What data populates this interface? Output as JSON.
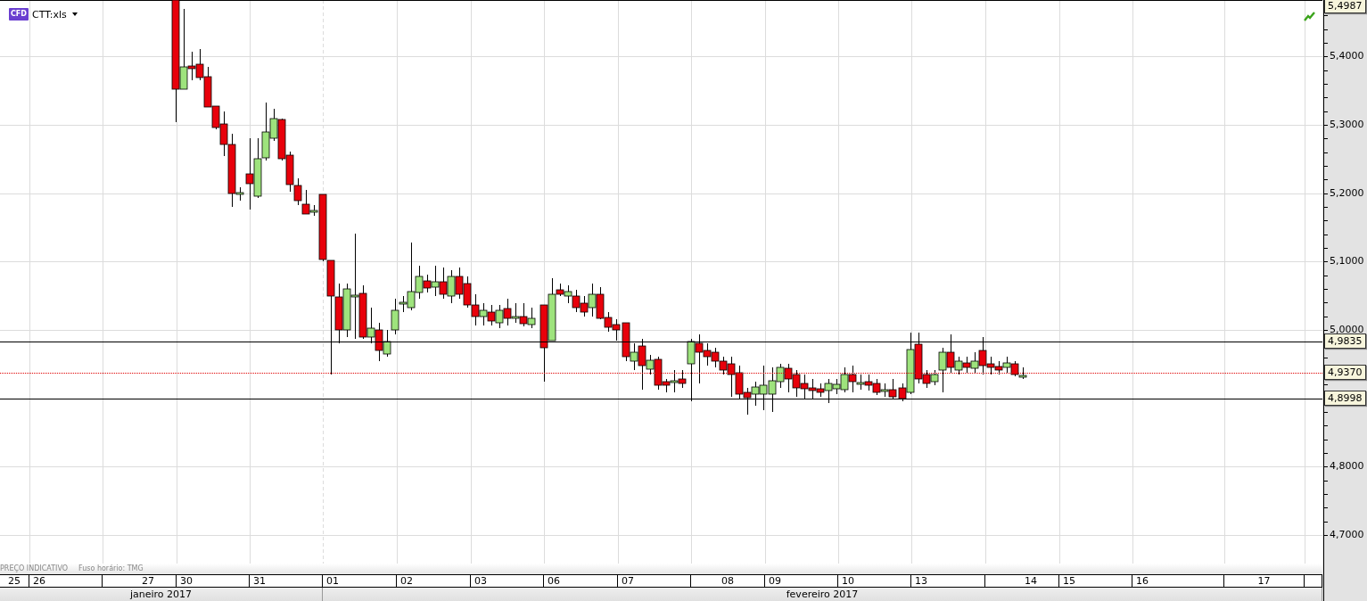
{
  "instrument": {
    "badge": "CFD",
    "name": "CTT:xls"
  },
  "y_axis_labels": [
    "5,4000",
    "5,3000",
    "5,2000",
    "5,1000",
    "5,0000",
    "4,8000",
    "4,7000"
  ],
  "price_tags": [
    {
      "label": "5,4987",
      "kind": "top"
    },
    {
      "label": "4,9835",
      "kind": "level"
    },
    {
      "label": "4,9370",
      "kind": "current"
    },
    {
      "label": "4,8998",
      "kind": "level"
    }
  ],
  "footer_note": {
    "price": "PREÇO INDICATIVO",
    "timezone": "Fuso horário: TMG"
  },
  "dates": [
    "25",
    "26",
    "27",
    "30",
    "31",
    "01",
    "02",
    "03",
    "06",
    "07",
    "08",
    "09",
    "10",
    "13",
    "14",
    "15",
    "16",
    "17"
  ],
  "months": [
    "janeiro 2017",
    "fevereiro 2017"
  ]
}
